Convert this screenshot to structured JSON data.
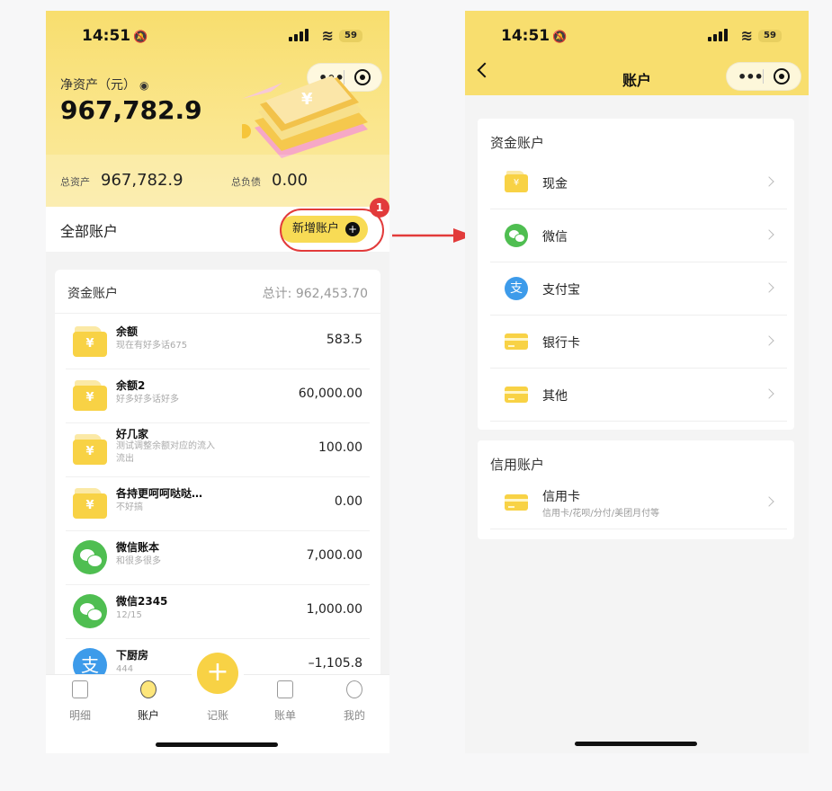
{
  "phone1": {
    "status": {
      "time": "14:51",
      "battery": "59"
    },
    "header": {
      "net_label": "净资产（元）",
      "net_value": "967,782.9",
      "assets_label": "总资产",
      "assets_value": "967,782.9",
      "debt_label": "总负债",
      "debt_value": "0.00"
    },
    "all_accounts_title": "全部账户",
    "add_account_label": "新增账户",
    "annotation_badge": "1",
    "card": {
      "title": "资金账户",
      "total": "总计:  962,453.70",
      "rows": [
        {
          "icon": "wallet-icon",
          "name": "余额",
          "desc": "现在有好多话675",
          "amount": "583.5"
        },
        {
          "icon": "wallet-icon",
          "name": "余额2",
          "desc": "好多好多话好多",
          "amount": "60,000.00"
        },
        {
          "icon": "wallet-icon",
          "name": "好几家",
          "desc": "测试调整余额对应的流入流出",
          "amount": "100.00"
        },
        {
          "icon": "wallet-icon",
          "name": "各持更呵呵哒哒…",
          "desc": "不好搞",
          "amount": "0.00"
        },
        {
          "icon": "wechat-icon",
          "name": "微信账本",
          "desc": "和很多很多",
          "amount": "7,000.00"
        },
        {
          "icon": "wechat-icon",
          "name": "微信2345",
          "desc": "12/15",
          "amount": "1,000.00"
        },
        {
          "icon": "alipay-icon",
          "name": "下厨房",
          "desc": "444",
          "amount": "–1,105.8"
        }
      ]
    },
    "tabs": [
      {
        "label": "明细"
      },
      {
        "label": "账户"
      },
      {
        "label": "记账"
      },
      {
        "label": "账单"
      },
      {
        "label": "我的"
      }
    ]
  },
  "phone2": {
    "status": {
      "time": "14:51",
      "battery": "59"
    },
    "title": "账户",
    "fund_section": {
      "title": "资金账户",
      "items": [
        {
          "icon": "wallet-icon",
          "name": "现金"
        },
        {
          "icon": "wechat-icon",
          "name": "微信"
        },
        {
          "icon": "alipay-icon",
          "name": "支付宝"
        },
        {
          "icon": "bank-card-icon",
          "name": "银行卡"
        },
        {
          "icon": "bank-card-icon",
          "name": "其他"
        }
      ]
    },
    "credit_section": {
      "title": "信用账户",
      "items": [
        {
          "icon": "credit-card-icon",
          "name": "信用卡",
          "desc": "信用卡/花呗/分付/美团月付等"
        }
      ]
    }
  },
  "colors": {
    "accent": "#f8d245",
    "annotation": "#e23b3b",
    "wechat": "#4fbe51",
    "alipay": "#3d9bea"
  }
}
